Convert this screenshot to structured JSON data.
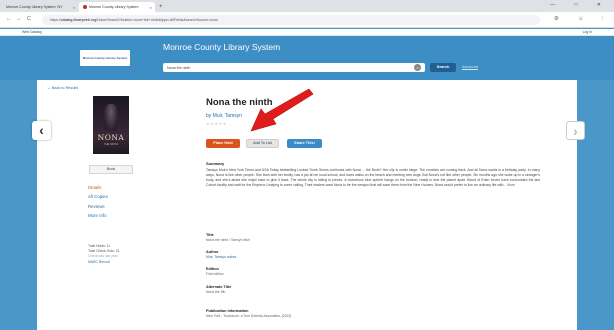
{
  "browser": {
    "tabs": [
      {
        "title": "Monroe County Library System, NY",
        "active": false
      },
      {
        "title": "Monroe County Library System",
        "active": true
      }
    ],
    "new_tab": "+",
    "window_controls": "— □ ✕",
    "back": "←",
    "forward": "→",
    "reload": "C",
    "url_prefix": "https://",
    "url_domain": "catalog.libraryweb.org",
    "url_path": "/Union/Search?lookfor=nona+the+ninth&type=AllFields&searchSource=local",
    "bookmark": "Web Catalog",
    "login": "Log In"
  },
  "site": {
    "logo_text": "Monroe County Library System",
    "title": "Monroe County Library System",
    "search_value": "Nona the ninth",
    "search_button": "Search",
    "advanced_link": "Advanced",
    "back_link": "← Back to Results",
    "prev_arrow": "‹",
    "next_arrow": "›"
  },
  "book": {
    "cover_title": "NONA",
    "cover_subtitle": "THE NINTH",
    "format": "Book",
    "title": "Nona the ninth",
    "author": "by Muir, Tamsyn",
    "rating": "★★★★★",
    "buttons": {
      "hold": "Place Hold",
      "list": "Add To List",
      "share": "Share This!"
    },
    "summary_header": "Summary",
    "summary_text": "Tamsyn Muir's New York Times and USA Today bestselling Locked Tomb Series continues with Nona ... the Ninth? Her city is under siege. The zombies are coming back. And all Nona wants is a birthday party. In many ways, Nona is like other people. She lives with her family, has a job at her local school, and loves walks on the beach and meeting new dogs. But Nona's not like other people. Six months ago she woke up in a stranger's body, and she's afraid she might have to give it back. The whole city is falling to pieces. A monstrous blue sphere hangs on the horizon, ready to tear the planet apart. Blood of Eden forces have surrounded the last Cohort facility and wait for the Emperor Undying to come calling. Their leaders want Nona to be the weapon that will save them from the Nine Houses. Nona would prefer to live an ordinary life with...",
    "summary_more": "More"
  },
  "side_nav": [
    {
      "label": "Details",
      "active": true
    },
    {
      "label": "All Copies",
      "active": false
    },
    {
      "label": "Reviews",
      "active": false
    },
    {
      "label": "More Info",
      "active": false
    }
  ],
  "stats": {
    "holds": "Total Holds: 11",
    "checkouts": "Total Check Outs: 21",
    "subtext": "Checkouts last year",
    "marc": "MARC Record"
  },
  "fields": [
    {
      "label": "Title",
      "value": "Nona the ninth / Tamsyn Muir",
      "link": false
    },
    {
      "label": "Author",
      "value": "Muir, Tamsyn author",
      "link": true
    },
    {
      "label": "Edition",
      "value": "First edition",
      "link": false
    },
    {
      "label": "Alternate Title",
      "value": "Nona the 9th",
      "link": false
    },
    {
      "label": "Publication Information",
      "value": "New York : Tordotcom, a Tom Doherty Associates, [2022]",
      "link": false
    }
  ],
  "colors": {
    "header": "#3d8ec4",
    "hold": "#d9531e",
    "share": "#3a8cc6",
    "annotation": "#e01b1b"
  }
}
